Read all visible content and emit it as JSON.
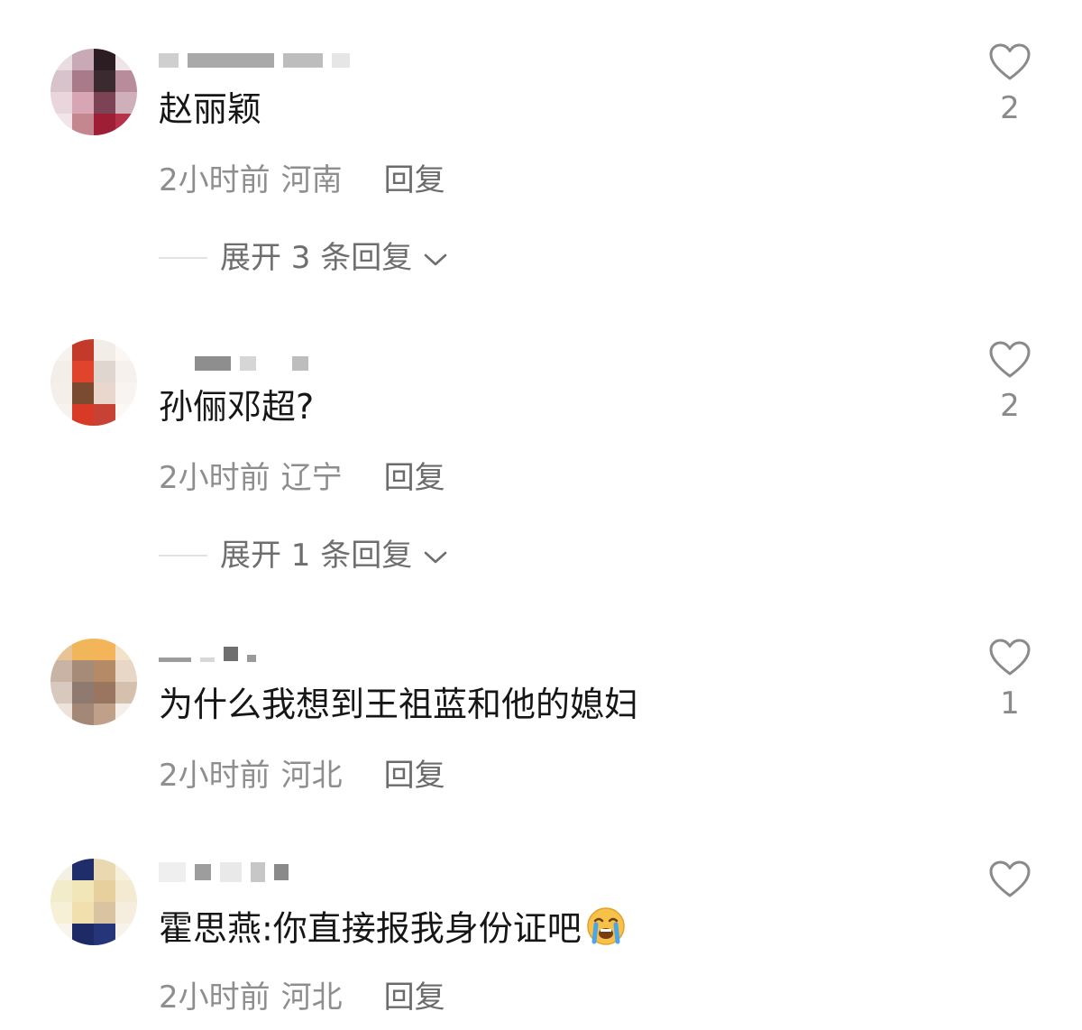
{
  "comments": [
    {
      "text": "赵丽颖",
      "time": "2小时前",
      "region": "河南",
      "reply_label": "回复",
      "expand_label": "展开 3 条回复",
      "likes": "2"
    },
    {
      "text": "孙俪邓超?",
      "time": "2小时前",
      "region": "辽宁",
      "reply_label": "回复",
      "expand_label": "展开 1 条回复",
      "likes": "2"
    },
    {
      "text": "为什么我想到王祖蓝和他的媳妇",
      "time": "2小时前",
      "region": "河北",
      "reply_label": "回复",
      "likes": "1"
    },
    {
      "text": "霍思燕:你直接报我身份证吧",
      "time": "2小时前",
      "region": "河北",
      "reply_label": "回复"
    }
  ],
  "icons": {
    "like": "heart-outline-icon",
    "expand": "chevron-down-icon",
    "emoji": "crying-face-emoji"
  },
  "colors": {
    "text": "#161616",
    "meta": "#8c8c8c",
    "reply": "#6b6b6b"
  }
}
